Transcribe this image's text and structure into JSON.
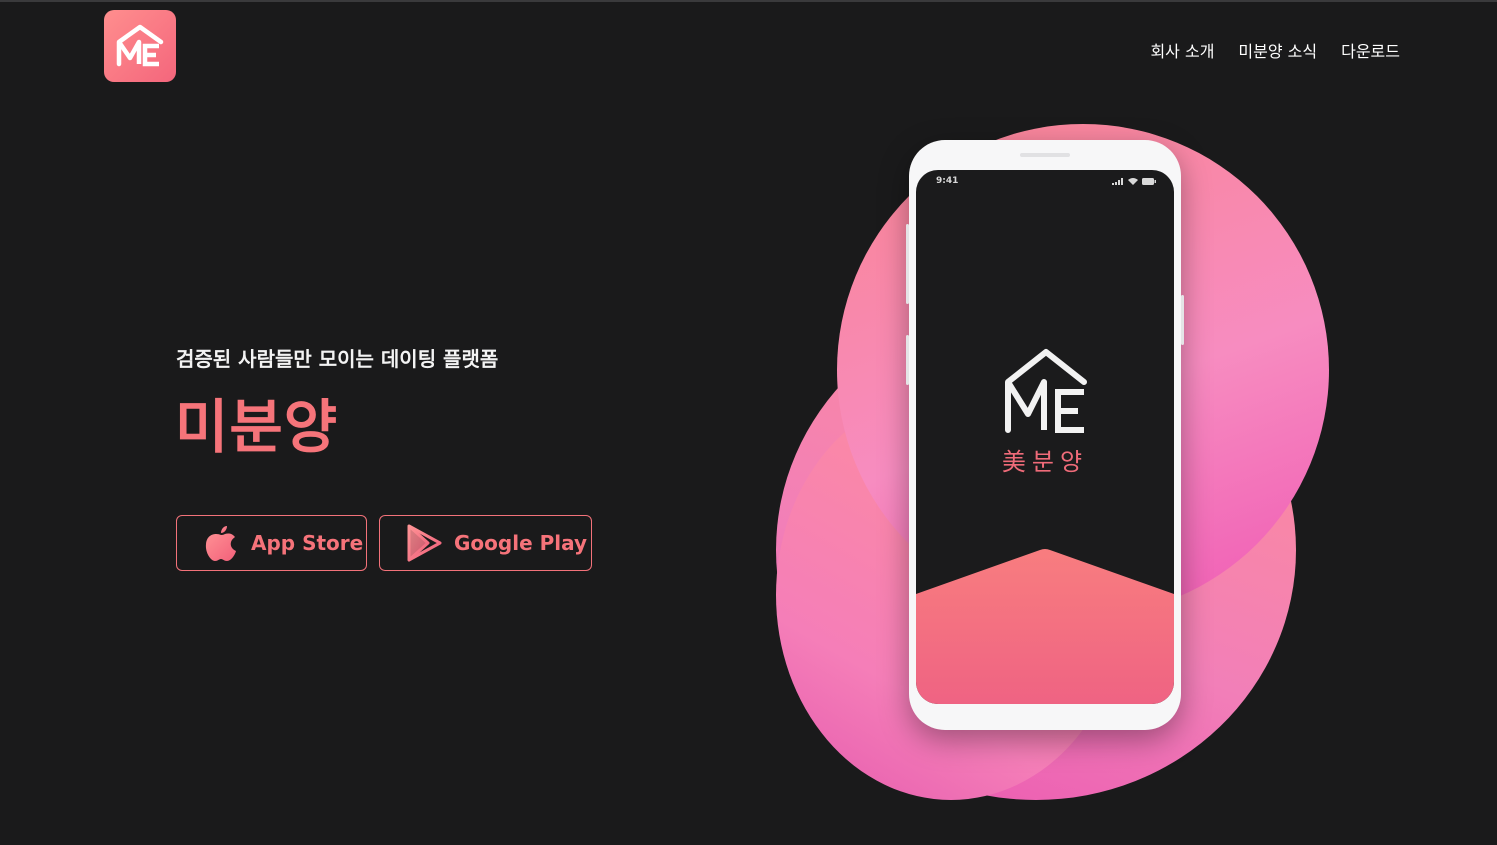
{
  "header": {
    "logo_icon": "me-house-logo-icon",
    "nav": [
      {
        "label": "회사 소개"
      },
      {
        "label": "미분양 소식"
      },
      {
        "label": "다운로드"
      }
    ]
  },
  "hero": {
    "tagline": "검증된 사람들만 모이는 데이팅 플랫폼",
    "title": "미분양",
    "buttons": {
      "app_store": {
        "label": "App Store",
        "icon": "apple-icon"
      },
      "google_play": {
        "label": "Google Play",
        "icon": "google-play-icon"
      }
    }
  },
  "phone": {
    "status_time": "9:41",
    "screen_brand": "美분양",
    "screen_logo_icon": "me-house-logo-icon"
  },
  "colors": {
    "background": "#1a1a1b",
    "accent": "#f6747a",
    "blob_pink": "#f78cc0"
  }
}
